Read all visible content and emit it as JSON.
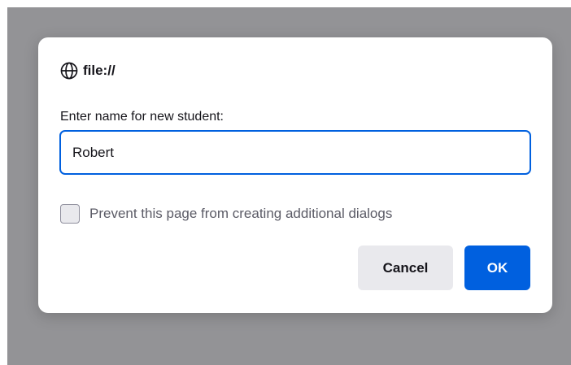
{
  "dialog": {
    "origin_text": "file://",
    "origin_icon": "globe-icon",
    "prompt_label": "Enter name for new student:",
    "input_value": "Robert",
    "checkbox_label": "Prevent this page from creating additional dialogs",
    "checkbox_checked": false,
    "cancel_label": "Cancel",
    "ok_label": "OK"
  },
  "colors": {
    "backdrop": "#939396",
    "accent": "#0060df",
    "secondary_button": "#e9e9ed"
  }
}
